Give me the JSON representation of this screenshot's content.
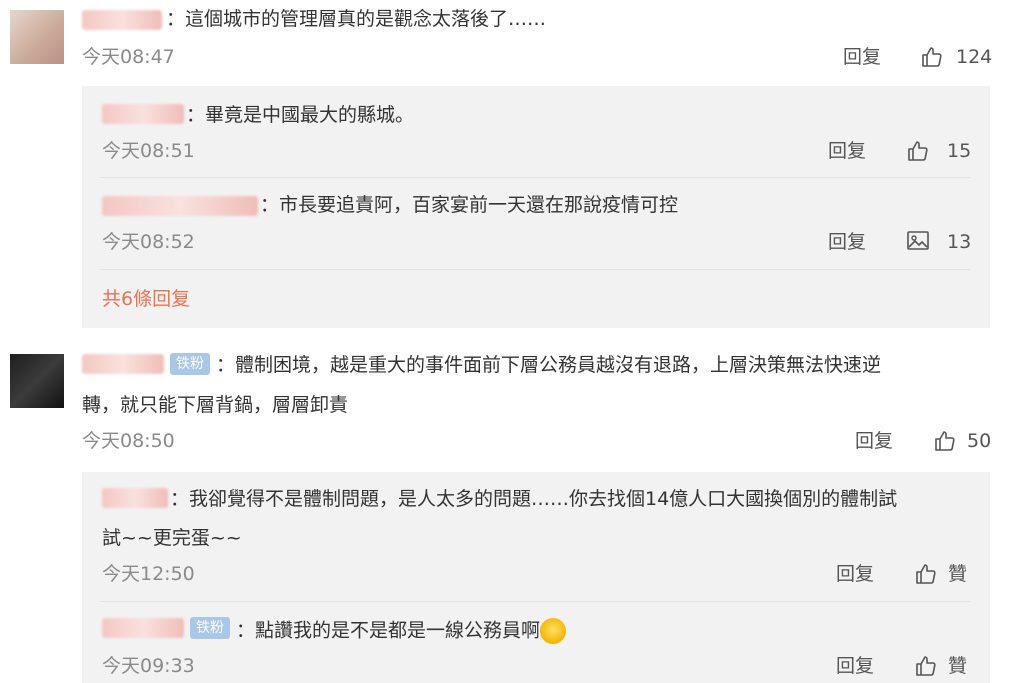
{
  "colors": {
    "accent": "#eb7350",
    "badge": "#a9c7e8",
    "panel": "#f2f2f2"
  },
  "comments": [
    {
      "text": "：這個城市的管理層真的是觀念太落後了……",
      "time": "今天08:47",
      "reply": "回复",
      "likes": "124",
      "replies": [
        {
          "text": "：畢竟是中國最大的縣城。",
          "time": "今天08:51",
          "reply": "回复",
          "likes": "15"
        },
        {
          "text": "：市長要追責阿，百家宴前一天還在那說疫情可控",
          "time": "今天08:52",
          "reply": "回复",
          "likes": "13"
        }
      ],
      "more": "共6條回复"
    },
    {
      "badge": "铁粉",
      "text_line1": "：體制困境，越是重大的事件面前下層公務員越沒有退路，上層決策無法快速逆",
      "text_line2": "轉，就只能下層背鍋，層層卸責",
      "time": "今天08:50",
      "reply": "回复",
      "likes": "50",
      "replies": [
        {
          "text_line1": "：我卻覺得不是體制問題，是人太多的問題……你去找個14億人口大國換個別的體制試",
          "text_line2": "試~~更完蛋~~",
          "time": "今天12:50",
          "reply": "回复",
          "likes": "贊"
        },
        {
          "badge": "铁粉",
          "text": "：點讚我的是不是都是一線公務員啊",
          "time": "今天09:33",
          "reply": "回复",
          "likes": "贊"
        }
      ]
    }
  ]
}
